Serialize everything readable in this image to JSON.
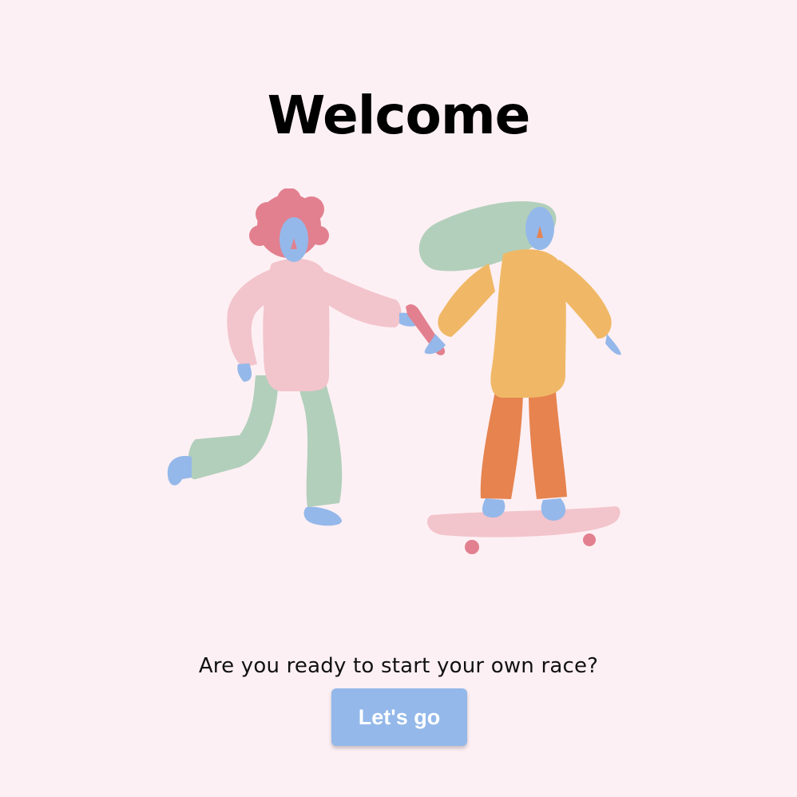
{
  "welcome": {
    "title": "Welcome",
    "question": "Are you ready to start your own race?",
    "cta_label": "Let's go"
  },
  "colors": {
    "background": "#fdf0f4",
    "button": "#94b8ea",
    "button_text": "#ffffff",
    "title_text": "#000000"
  },
  "illustration": {
    "figures": [
      "person-running",
      "person-skateboarding"
    ],
    "props": [
      "skateboard"
    ]
  }
}
